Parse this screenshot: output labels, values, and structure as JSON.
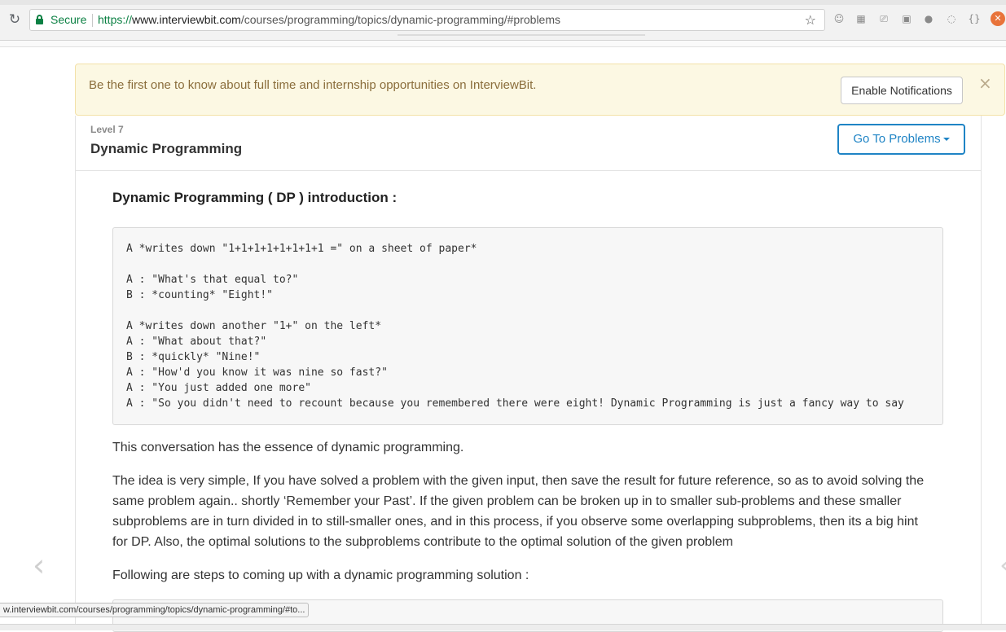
{
  "browser": {
    "secure_label": "Secure",
    "url_protocol": "https://",
    "url_host": "www.interviewbit.com",
    "url_path": "/courses/programming/topics/dynamic-programming/#problems",
    "status_url": "w.interviewbit.com/courses/programming/topics/dynamic-programming/#to..."
  },
  "notification": {
    "text": "Be the first one to know about full time and internship opportunities on InterviewBit.",
    "button_label": "Enable Notifications",
    "close_glyph": "×"
  },
  "topic": {
    "level": "Level 7",
    "title": "Dynamic Programming",
    "goto_label": "Go To Problems"
  },
  "content": {
    "section_title": "Dynamic Programming ( DP ) introduction :",
    "code_lines": [
      "A *writes down \"1+1+1+1+1+1+1+1 =\" on a sheet of paper*",
      "A : \"What's that equal to?\"",
      "B : *counting* \"Eight!\"",
      "A *writes down another \"1+\" on the left*",
      "A : \"What about that?\"",
      "B : *quickly* \"Nine!\"",
      "A : \"How'd you know it was nine so fast?\"",
      "A : \"You just added one more\"",
      "A : \"So you didn't need to recount because you remembered there were eight! Dynamic Programming is just a fancy way to say"
    ],
    "para1": "This conversation has the essence of dynamic programming.",
    "para2": "The idea is very simple, If you have solved a problem with the given input, then save the result for future reference, so as to avoid solving the same problem again.. shortly ‘Remember your Past’. If the given problem can be broken up in to smaller sub-problems and these smaller subproblems are in turn divided in to still-smaller ones, and in this process, if you observe some overlapping subproblems, then its a big hint for DP. Also, the optimal solutions to the subproblems contribute to the optimal solution of the given problem",
    "para3": "Following are steps to coming up with a dynamic programming solution :"
  },
  "icons": {
    "reload": "↻",
    "star": "☆",
    "prev": "‹",
    "next": "‹"
  }
}
